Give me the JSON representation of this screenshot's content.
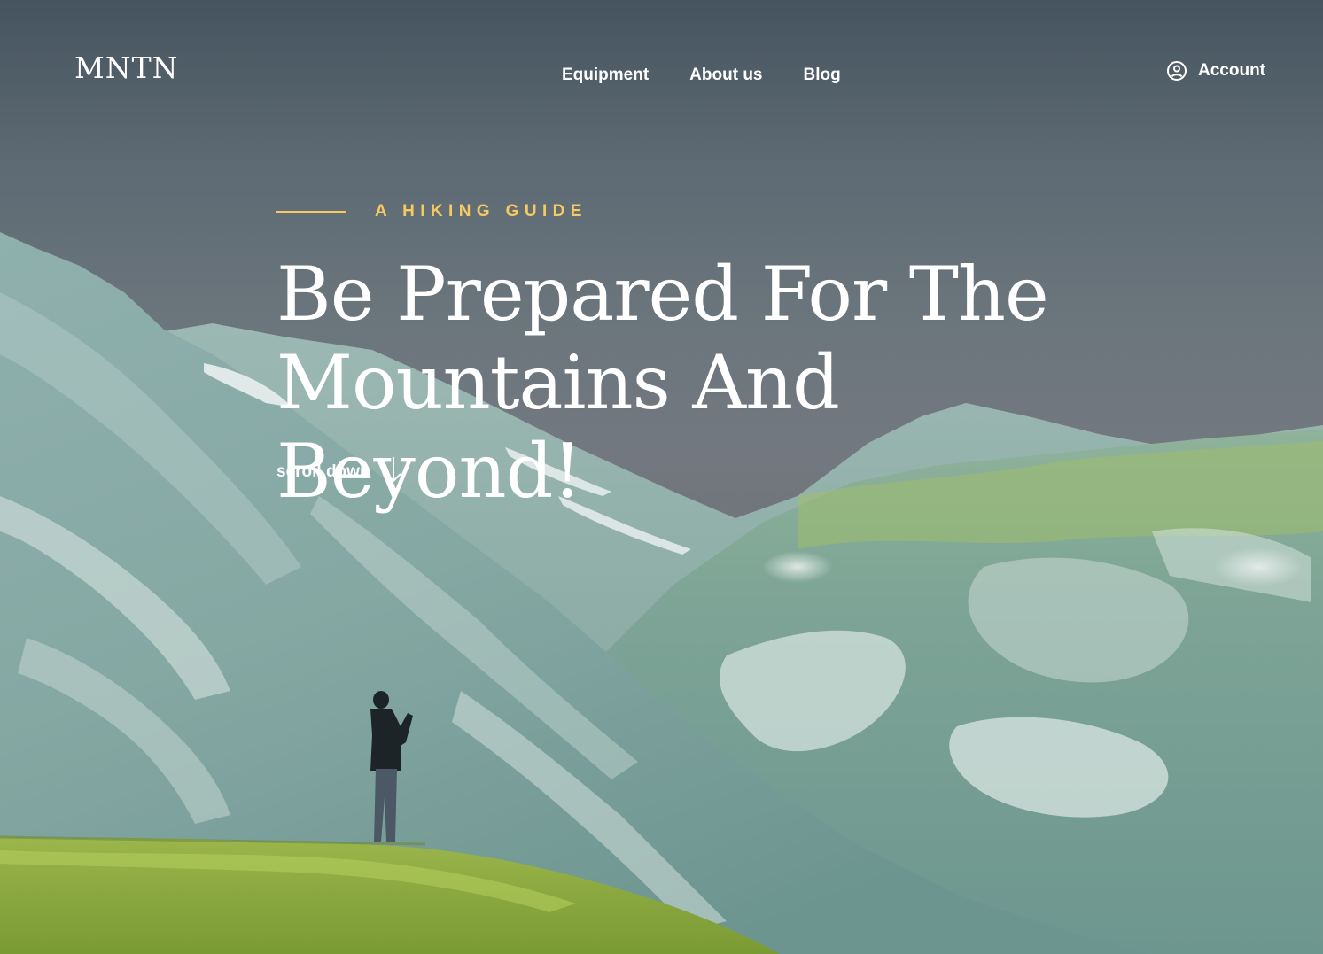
{
  "brand": {
    "logo": "MNTN"
  },
  "nav": {
    "items": [
      {
        "label": "Equipment"
      },
      {
        "label": "About us"
      },
      {
        "label": "Blog"
      }
    ],
    "account_label": "Account"
  },
  "hero": {
    "kicker": "A HIKING GUIDE",
    "headline_line1": "Be Prepared For The",
    "headline_line2": "Mountains And Beyond!",
    "scroll_label": "scroll down"
  },
  "colors": {
    "accent": "#f6c962",
    "text": "#ffffff",
    "sky": "#5e6b74"
  },
  "icons": {
    "account": "user-circle-icon",
    "scroll": "arrow-down-icon"
  }
}
